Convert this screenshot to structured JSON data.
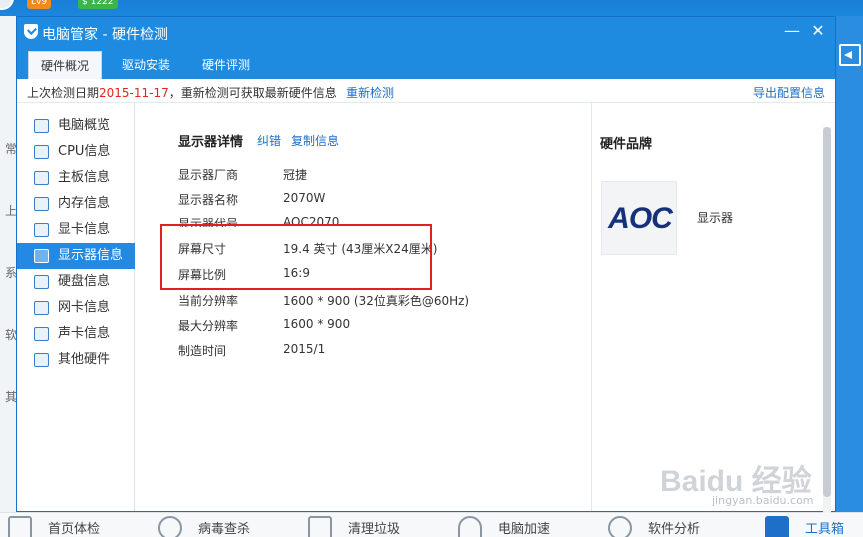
{
  "bg": {
    "level_badge": "Lv9",
    "vip_badge": "$ 1222",
    "left_chars": [
      "常",
      "上",
      "系",
      "软",
      "其"
    ],
    "bottom_bar": [
      {
        "label": "首页体检",
        "icon": "chart-icon"
      },
      {
        "label": "病毒查杀",
        "icon": "target-icon"
      },
      {
        "label": "清理垃圾",
        "icon": "broom-icon"
      },
      {
        "label": "电脑加速",
        "icon": "rocket-icon"
      },
      {
        "label": "软件分析",
        "icon": "software-icon"
      },
      {
        "label": "工具箱",
        "icon": "toolbox-icon"
      }
    ]
  },
  "window": {
    "title": "电脑管家 - 硬件检测",
    "min_glyph": "—",
    "close_glyph": "✕"
  },
  "tabs": [
    {
      "label": "硬件概况",
      "active": true
    },
    {
      "label": "驱动安装",
      "active": false
    },
    {
      "label": "硬件评测",
      "active": false
    }
  ],
  "infobar": {
    "prefix": "上次检测日期",
    "date": "2015-11-17",
    "suffix": "，重新检测可获取最新硬件信息",
    "recheck": "重新检测",
    "export": "导出配置信息"
  },
  "sidebar": [
    {
      "label": "电脑概览",
      "icon": "overview-icon"
    },
    {
      "label": "CPU信息",
      "icon": "cpu-icon"
    },
    {
      "label": "主板信息",
      "icon": "motherboard-icon"
    },
    {
      "label": "内存信息",
      "icon": "memory-icon"
    },
    {
      "label": "显卡信息",
      "icon": "gpu-icon"
    },
    {
      "label": "显示器信息",
      "icon": "monitor-icon",
      "active": true
    },
    {
      "label": "硬盘信息",
      "icon": "harddisk-icon"
    },
    {
      "label": "网卡信息",
      "icon": "network-card-icon"
    },
    {
      "label": "声卡信息",
      "icon": "sound-card-icon"
    },
    {
      "label": "其他硬件",
      "icon": "other-hardware-icon"
    }
  ],
  "detail": {
    "title": "显示器详情",
    "correct": "纠错",
    "copy": "复制信息",
    "rows": [
      {
        "key": "显示器厂商",
        "value": "冠捷"
      },
      {
        "key": "显示器名称",
        "value": "2070W"
      },
      {
        "key": "显示器代号",
        "value": "AOC2070"
      },
      {
        "key": "屏幕尺寸",
        "value": "19.4 英寸 (43厘米X24厘米)"
      },
      {
        "key": "屏幕比例",
        "value": "16:9"
      },
      {
        "key": "当前分辨率",
        "value": "1600 * 900 (32位真彩色@60Hz)"
      },
      {
        "key": "最大分辨率",
        "value": "1600 * 900"
      },
      {
        "key": "制造时间",
        "value": "2015/1"
      }
    ]
  },
  "brand": {
    "title": "硬件品牌",
    "logo_text": "AOC",
    "label": "显示器"
  },
  "watermark": {
    "main": "Baidu 经验",
    "url": "jingyan.baidu.com"
  }
}
